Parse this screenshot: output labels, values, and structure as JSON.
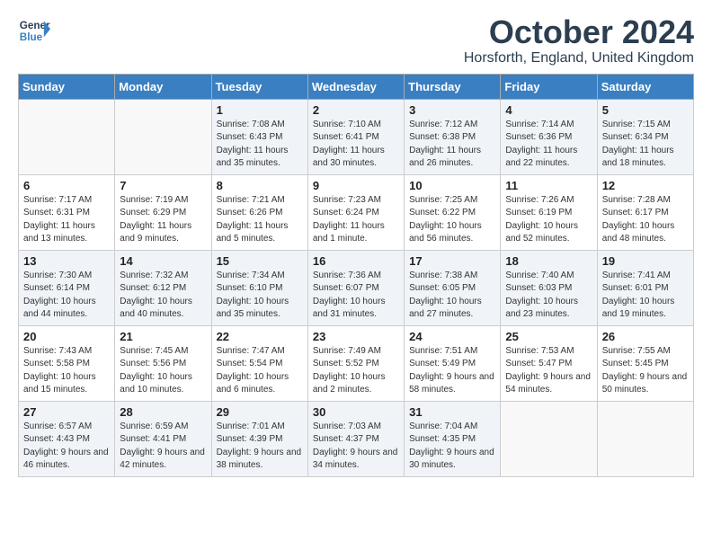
{
  "logo": {
    "line1": "General",
    "line2": "Blue"
  },
  "title": "October 2024",
  "location": "Horsforth, England, United Kingdom",
  "weekdays": [
    "Sunday",
    "Monday",
    "Tuesday",
    "Wednesday",
    "Thursday",
    "Friday",
    "Saturday"
  ],
  "weeks": [
    [
      {
        "day": "",
        "info": ""
      },
      {
        "day": "",
        "info": ""
      },
      {
        "day": "1",
        "info": "Sunrise: 7:08 AM\nSunset: 6:43 PM\nDaylight: 11 hours and 35 minutes."
      },
      {
        "day": "2",
        "info": "Sunrise: 7:10 AM\nSunset: 6:41 PM\nDaylight: 11 hours and 30 minutes."
      },
      {
        "day": "3",
        "info": "Sunrise: 7:12 AM\nSunset: 6:38 PM\nDaylight: 11 hours and 26 minutes."
      },
      {
        "day": "4",
        "info": "Sunrise: 7:14 AM\nSunset: 6:36 PM\nDaylight: 11 hours and 22 minutes."
      },
      {
        "day": "5",
        "info": "Sunrise: 7:15 AM\nSunset: 6:34 PM\nDaylight: 11 hours and 18 minutes."
      }
    ],
    [
      {
        "day": "6",
        "info": "Sunrise: 7:17 AM\nSunset: 6:31 PM\nDaylight: 11 hours and 13 minutes."
      },
      {
        "day": "7",
        "info": "Sunrise: 7:19 AM\nSunset: 6:29 PM\nDaylight: 11 hours and 9 minutes."
      },
      {
        "day": "8",
        "info": "Sunrise: 7:21 AM\nSunset: 6:26 PM\nDaylight: 11 hours and 5 minutes."
      },
      {
        "day": "9",
        "info": "Sunrise: 7:23 AM\nSunset: 6:24 PM\nDaylight: 11 hours and 1 minute."
      },
      {
        "day": "10",
        "info": "Sunrise: 7:25 AM\nSunset: 6:22 PM\nDaylight: 10 hours and 56 minutes."
      },
      {
        "day": "11",
        "info": "Sunrise: 7:26 AM\nSunset: 6:19 PM\nDaylight: 10 hours and 52 minutes."
      },
      {
        "day": "12",
        "info": "Sunrise: 7:28 AM\nSunset: 6:17 PM\nDaylight: 10 hours and 48 minutes."
      }
    ],
    [
      {
        "day": "13",
        "info": "Sunrise: 7:30 AM\nSunset: 6:14 PM\nDaylight: 10 hours and 44 minutes."
      },
      {
        "day": "14",
        "info": "Sunrise: 7:32 AM\nSunset: 6:12 PM\nDaylight: 10 hours and 40 minutes."
      },
      {
        "day": "15",
        "info": "Sunrise: 7:34 AM\nSunset: 6:10 PM\nDaylight: 10 hours and 35 minutes."
      },
      {
        "day": "16",
        "info": "Sunrise: 7:36 AM\nSunset: 6:07 PM\nDaylight: 10 hours and 31 minutes."
      },
      {
        "day": "17",
        "info": "Sunrise: 7:38 AM\nSunset: 6:05 PM\nDaylight: 10 hours and 27 minutes."
      },
      {
        "day": "18",
        "info": "Sunrise: 7:40 AM\nSunset: 6:03 PM\nDaylight: 10 hours and 23 minutes."
      },
      {
        "day": "19",
        "info": "Sunrise: 7:41 AM\nSunset: 6:01 PM\nDaylight: 10 hours and 19 minutes."
      }
    ],
    [
      {
        "day": "20",
        "info": "Sunrise: 7:43 AM\nSunset: 5:58 PM\nDaylight: 10 hours and 15 minutes."
      },
      {
        "day": "21",
        "info": "Sunrise: 7:45 AM\nSunset: 5:56 PM\nDaylight: 10 hours and 10 minutes."
      },
      {
        "day": "22",
        "info": "Sunrise: 7:47 AM\nSunset: 5:54 PM\nDaylight: 10 hours and 6 minutes."
      },
      {
        "day": "23",
        "info": "Sunrise: 7:49 AM\nSunset: 5:52 PM\nDaylight: 10 hours and 2 minutes."
      },
      {
        "day": "24",
        "info": "Sunrise: 7:51 AM\nSunset: 5:49 PM\nDaylight: 9 hours and 58 minutes."
      },
      {
        "day": "25",
        "info": "Sunrise: 7:53 AM\nSunset: 5:47 PM\nDaylight: 9 hours and 54 minutes."
      },
      {
        "day": "26",
        "info": "Sunrise: 7:55 AM\nSunset: 5:45 PM\nDaylight: 9 hours and 50 minutes."
      }
    ],
    [
      {
        "day": "27",
        "info": "Sunrise: 6:57 AM\nSunset: 4:43 PM\nDaylight: 9 hours and 46 minutes."
      },
      {
        "day": "28",
        "info": "Sunrise: 6:59 AM\nSunset: 4:41 PM\nDaylight: 9 hours and 42 minutes."
      },
      {
        "day": "29",
        "info": "Sunrise: 7:01 AM\nSunset: 4:39 PM\nDaylight: 9 hours and 38 minutes."
      },
      {
        "day": "30",
        "info": "Sunrise: 7:03 AM\nSunset: 4:37 PM\nDaylight: 9 hours and 34 minutes."
      },
      {
        "day": "31",
        "info": "Sunrise: 7:04 AM\nSunset: 4:35 PM\nDaylight: 9 hours and 30 minutes."
      },
      {
        "day": "",
        "info": ""
      },
      {
        "day": "",
        "info": ""
      }
    ]
  ]
}
